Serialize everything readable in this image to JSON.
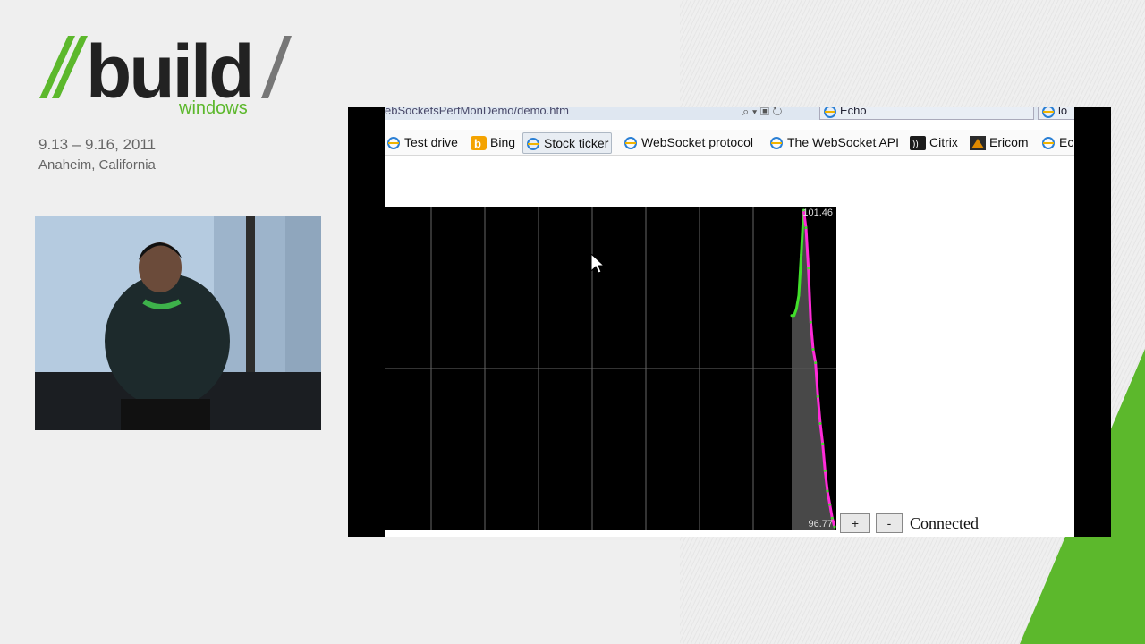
{
  "branding": {
    "logo_main": "//build/",
    "logo_word": "build",
    "logo_sub": "windows",
    "date": "9.13 – 9.16, 2011",
    "location": "Anaheim, California",
    "accent_color": "#5cb82c"
  },
  "browser": {
    "address_url": "ebSocketsPerfMonDemo/demo.htm",
    "tabs": [
      {
        "label": "Echo",
        "icon": "ie-icon"
      },
      {
        "label": "lo",
        "icon": "ie-icon"
      }
    ],
    "favorites": [
      {
        "label": "Test drive",
        "icon": "ie-icon"
      },
      {
        "label": "Bing",
        "icon": "bing-icon"
      },
      {
        "label": "Stock ticker",
        "icon": "ie-icon",
        "active": true
      },
      {
        "label": "WebSocket protocol",
        "icon": "ie-icon"
      },
      {
        "label": "The WebSocket API",
        "icon": "ie-icon"
      },
      {
        "label": "Citrix",
        "icon": "citrix-icon"
      },
      {
        "label": "Ericom",
        "icon": "ericom-icon"
      },
      {
        "label": "Ec",
        "icon": "ie-icon"
      }
    ]
  },
  "ticker": {
    "max_label": "101.46",
    "min_label": "96.77",
    "plus_label": "+",
    "minus_label": "-",
    "status_text": "Connected",
    "series_color_up": "#41e02a",
    "series_color_down": "#ff2bd9"
  },
  "chart_data": {
    "type": "line",
    "ylim": [
      96.77,
      101.46
    ],
    "grid": true,
    "series": [
      {
        "values": [
          99.9,
          99.9,
          100.0,
          100.2,
          100.8,
          101.46,
          101.2,
          100.6,
          99.8,
          99.4,
          99.2,
          98.7,
          98.3,
          98.0,
          97.6,
          97.3,
          97.1,
          96.9,
          96.77
        ]
      }
    ]
  }
}
